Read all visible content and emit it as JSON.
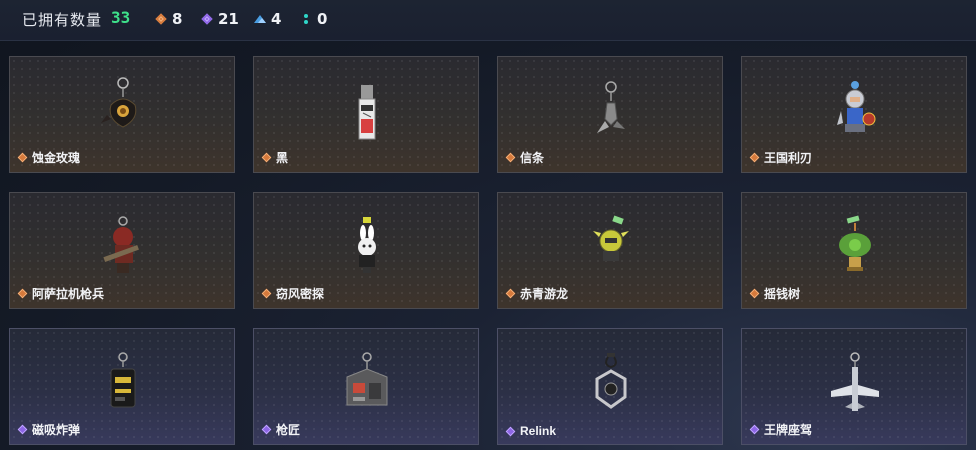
{
  "header": {
    "owned_label": "已拥有数量",
    "owned_count": "33",
    "stats": [
      {
        "icon": "orange-gem-icon",
        "value": "8"
      },
      {
        "icon": "purple-gem-icon",
        "value": "21"
      },
      {
        "icon": "blue-mountain-icon",
        "value": "4"
      },
      {
        "icon": "teal-dots-icon",
        "value": "0"
      }
    ]
  },
  "colors": {
    "accent_green": "#3ee08a",
    "rarity_orange": "#d67a3c",
    "rarity_purple": "#8e66e6"
  },
  "items": [
    {
      "name": "蚀金玫瑰",
      "rarity": "orange"
    },
    {
      "name": "黑",
      "rarity": "orange"
    },
    {
      "name": "信条",
      "rarity": "orange"
    },
    {
      "name": "王国利刃",
      "rarity": "orange"
    },
    {
      "name": "阿萨拉机枪兵",
      "rarity": "orange"
    },
    {
      "name": "窃风密探",
      "rarity": "orange"
    },
    {
      "name": "赤青游龙",
      "rarity": "orange"
    },
    {
      "name": "摇钱树",
      "rarity": "orange"
    },
    {
      "name": "磁吸炸弹",
      "rarity": "purple"
    },
    {
      "name": "枪匠",
      "rarity": "purple"
    },
    {
      "name": "Relink",
      "rarity": "purple"
    },
    {
      "name": "王牌座驾",
      "rarity": "purple"
    }
  ]
}
